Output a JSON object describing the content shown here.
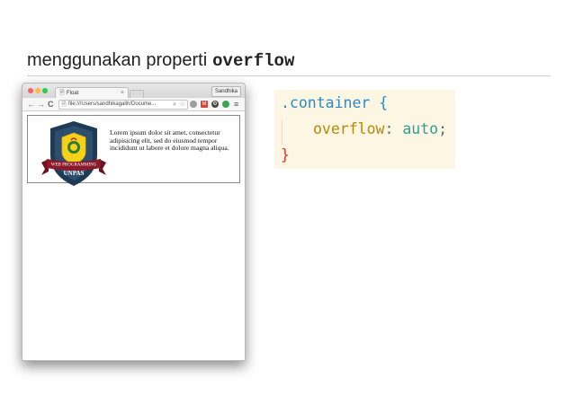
{
  "slide": {
    "title_text": "menggunakan properti",
    "title_code": "overflow"
  },
  "browser": {
    "tab_title": "Float",
    "tab_close": "×",
    "user_name": "Sandhika",
    "url": "file:///Users/sandhikagalih/Docume...",
    "nav": {
      "back": "←",
      "forward": "→",
      "reload": "C"
    },
    "menu": "≡"
  },
  "page": {
    "logo": {
      "line1": "WEB PROGRAMMING",
      "line2": "UNPAS"
    },
    "lorem": "Lorem ipsum dolor sit amet, consectetur adipisicing elit, sed do eiusmod tempor incididunt ut labore et dolore magna aliqua."
  },
  "code": {
    "selector": ".container",
    "open_brace": "{",
    "property": "overflow",
    "colon": ":",
    "value": "auto",
    "semicolon": ";",
    "close_brace": "}"
  },
  "colors": {
    "code_bg": "#fdf6e3",
    "selector": "#268bd2",
    "property": "#b58900",
    "value": "#2aa198",
    "close_brace": "#dc322f",
    "shield_navy": "#1e3a55",
    "banner_red": "#8b1a2b"
  },
  "icons": [
    "doc-icon",
    "close-icon",
    "back-arrow-icon",
    "forward-arrow-icon",
    "reload-icon",
    "magnifier-icon",
    "star-icon",
    "gmail-icon",
    "gear-icon",
    "extension-icon",
    "menu-icon"
  ]
}
